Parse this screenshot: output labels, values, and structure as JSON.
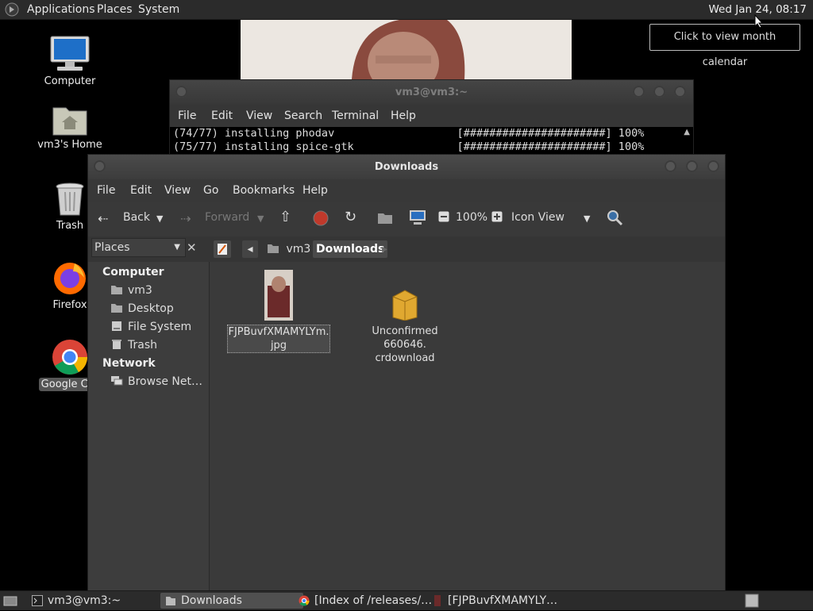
{
  "top_panel": {
    "menus": [
      "Applications",
      "Places",
      "System"
    ],
    "clock": "Wed Jan 24, 08:17",
    "tooltip": "Click to view month calendar"
  },
  "desktop": {
    "icons": [
      {
        "label": "Computer",
        "icon": "computer-icon"
      },
      {
        "label": "vm3's Home",
        "icon": "home-folder-icon"
      },
      {
        "label": "Trash",
        "icon": "trash-icon"
      },
      {
        "label": "Firefox",
        "icon": "firefox-icon"
      },
      {
        "label": "Google Chr",
        "icon": "chrome-icon"
      }
    ]
  },
  "terminal": {
    "title": "vm3@vm3:~",
    "menu": [
      "File",
      "Edit",
      "View",
      "Search",
      "Terminal",
      "Help"
    ],
    "lines": [
      "(74/77) installing phodav                   [######################] 100%",
      "(75/77) installing spice-gtk                [######################] 100%"
    ]
  },
  "file_manager": {
    "title": "Downloads",
    "menu": [
      "File",
      "Edit",
      "View",
      "Go",
      "Bookmarks",
      "Help"
    ],
    "toolbar": {
      "back": "Back",
      "forward": "Forward",
      "zoom": "100%",
      "view_mode": "Icon View"
    },
    "sidebar": {
      "combo": "Places",
      "sections": [
        {
          "heading": "Computer",
          "items": [
            "vm3",
            "Desktop",
            "File System",
            "Trash"
          ]
        },
        {
          "heading": "Network",
          "items": [
            "Browse Net…"
          ]
        }
      ]
    },
    "breadcrumb": [
      "vm3",
      "Downloads"
    ],
    "files": [
      {
        "name_line1": "FJPBuvfXMAMYLYm.",
        "name_line2": "jpg",
        "icon": "image-thumbnail-icon",
        "selected": true
      },
      {
        "name_line1": "Unconfirmed 660646.",
        "name_line2": "crdownload",
        "icon": "package-icon",
        "selected": false
      }
    ]
  },
  "taskbar": {
    "tasks": [
      {
        "label": "vm3@vm3:~",
        "icon": "terminal-icon"
      },
      {
        "label": "Downloads",
        "icon": "folder-icon"
      },
      {
        "label": "[Index of /releases/…",
        "icon": "chrome-icon"
      },
      {
        "label": "[FJPBuvfXMAMYLY…",
        "icon": "image-icon"
      }
    ]
  }
}
